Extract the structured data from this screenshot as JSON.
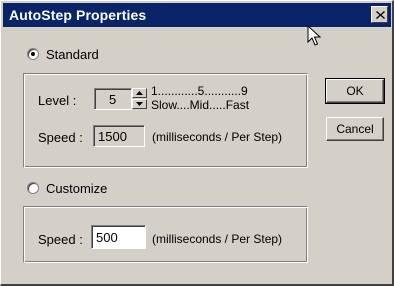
{
  "window": {
    "title": "AutoStep Properties"
  },
  "standard": {
    "radio_label": "Standard",
    "selected": true,
    "level_label": "Level :",
    "level_value": "5",
    "scale_numbers": "1............5...........9",
    "scale_words": "Slow....Mid.....Fast",
    "speed_label": "Speed :",
    "speed_value": "1500",
    "speed_unit": "(milliseconds / Per Step)"
  },
  "customize": {
    "radio_label": "Customize",
    "selected": false,
    "speed_label": "Speed :",
    "speed_value": "500",
    "speed_unit": "(milliseconds / Per Step)"
  },
  "buttons": {
    "ok": "OK",
    "cancel": "Cancel"
  },
  "icons": {
    "close": "close-icon",
    "spin_up": "triangle-up-icon",
    "spin_down": "triangle-down-icon",
    "cursor": "mouse-pointer-icon"
  },
  "colors": {
    "titlebar": "#0a246a",
    "face": "#d4d0c8",
    "field": "#ffffff"
  }
}
